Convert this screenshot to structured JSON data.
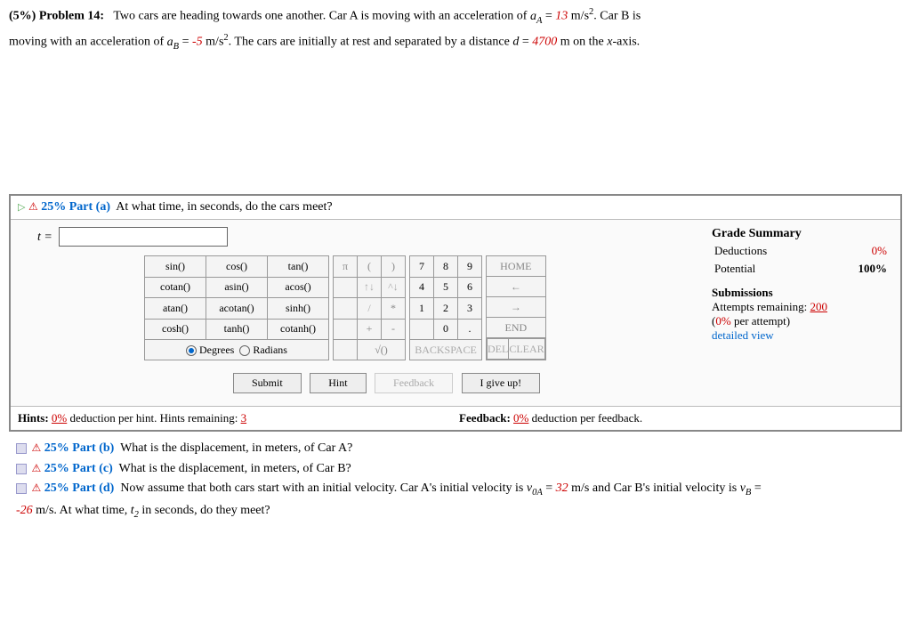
{
  "problem": {
    "percent": "(5%)",
    "label": "Problem 14:",
    "text1a": "Two cars are heading towards one another. Car A is moving with an acceleration of ",
    "aA_sym": "a",
    "aA_sub": "A",
    "eq": " = ",
    "aA_val": "13",
    "unitsA": " m/s",
    "text1b": ". Car B is",
    "text2a": "moving with an acceleration of ",
    "aB_sub": "B",
    "aB_val": "-5",
    "unitsB": " m/s",
    "text2b": ". The cars are initially at rest and separated by a distance ",
    "d_sym": "d",
    "d_val": "4700",
    "d_unit": " m on the ",
    "xaxis": "x",
    "text2c": "-axis."
  },
  "partA": {
    "pct": "25%",
    "label": "Part (a)",
    "q": "At what time, in seconds, do the cars meet?",
    "var": "t =",
    "input": ""
  },
  "grade": {
    "hdr": "Grade Summary",
    "ded_l": "Deductions",
    "ded_v": "0%",
    "pot_l": "Potential",
    "pot_v": "100%",
    "sub_hdr": "Submissions",
    "att_l": "Attempts remaining: ",
    "att_v": "200",
    "per_a": "(",
    "per_v": "0%",
    "per_b": " per attempt)",
    "detail": "detailed view"
  },
  "keypad": {
    "fn": [
      [
        "sin()",
        "cos()",
        "tan()"
      ],
      [
        "cotan()",
        "asin()",
        "acos()"
      ],
      [
        "atan()",
        "acotan()",
        "sinh()"
      ],
      [
        "cosh()",
        "tanh()",
        "cotanh()"
      ]
    ],
    "mode_deg": "Degrees",
    "mode_rad": "Radians",
    "ops": [
      [
        "π",
        "(",
        ")"
      ],
      [
        "",
        "↑↓",
        "^↓"
      ],
      [
        "",
        "/",
        "*"
      ],
      [
        "",
        "+",
        "-"
      ],
      [
        "",
        "√()",
        ""
      ]
    ],
    "nums": [
      [
        "7",
        "8",
        "9"
      ],
      [
        "4",
        "5",
        "6"
      ],
      [
        "1",
        "2",
        "3"
      ],
      [
        "",
        "0",
        "."
      ]
    ],
    "ctrl": [
      "HOME",
      "←",
      "→",
      "END"
    ],
    "back": "BACKSPACE",
    "del": "DEL",
    "clear": "CLEAR"
  },
  "buttons": {
    "submit": "Submit",
    "hint": "Hint",
    "feedback": "Feedback",
    "giveup": "I give up!"
  },
  "hints": {
    "h_label": "Hints:",
    "h_ded": "0%",
    "h_text": " deduction per hint. Hints remaining: ",
    "h_rem": "3",
    "f_label": "Feedback:",
    "f_ded": "0%",
    "f_text": " deduction per feedback."
  },
  "partsB": {
    "pctB": "25%",
    "lblB": "Part (b)",
    "qB": "What is the displacement, in meters, of Car A?",
    "pctC": "25%",
    "lblC": "Part (c)",
    "qC": "What is the displacement, in meters, of Car B?",
    "pctD": "25%",
    "lblD": "Part (d)",
    "qD1": "Now assume that both cars start with an initial velocity. Car A's initial velocity is ",
    "v0A": "v",
    "v0Asub": "0A",
    "v0Aval": "32",
    "v0Aunit": " m/s and Car B's initial velocity is ",
    "v0B": "v",
    "v0Bsub": "B",
    "eq2": " =",
    "vBval": "-26",
    "vBunit": " m/s. At what time, ",
    "t2": "t",
    "t2sub": "2",
    "qD2": " in seconds, do they meet?"
  }
}
